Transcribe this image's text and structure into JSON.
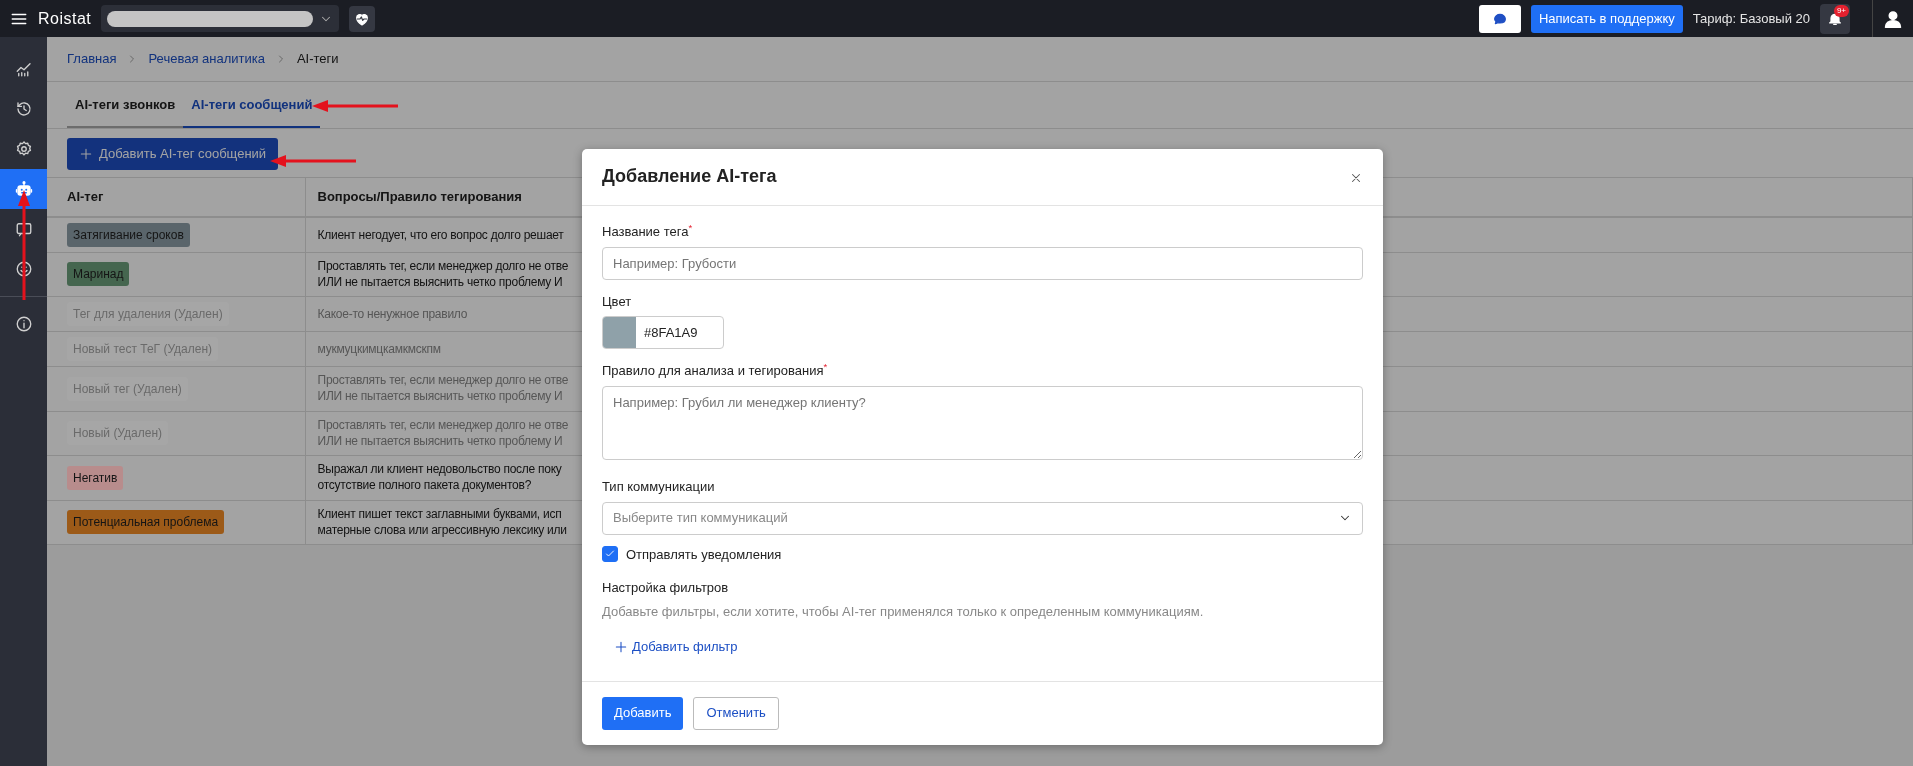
{
  "topbar": {
    "logo": "Roistat",
    "support_button": "Написать в поддержку",
    "tariff": "Тариф: Базовый 20",
    "notifications_badge": "9+"
  },
  "sidebar": {
    "items": [
      {
        "kind": "chart",
        "selected": false
      },
      {
        "kind": "history",
        "selected": false
      },
      {
        "kind": "settings",
        "selected": false
      },
      {
        "kind": "robot",
        "selected": true
      },
      {
        "kind": "chat",
        "selected": false
      },
      {
        "kind": "smile",
        "selected": false
      },
      {
        "kind": "info",
        "selected": false
      }
    ]
  },
  "breadcrumbs": [
    {
      "label": "Главная",
      "link": true
    },
    {
      "label": "Речевая аналитика",
      "link": true
    },
    {
      "label": "AI-теги",
      "link": false
    }
  ],
  "tabs": [
    {
      "label": "AI-теги звонков",
      "selected": false
    },
    {
      "label": "AI-теги сообщений",
      "selected": true
    }
  ],
  "add_button": "Добавить AI-тег сообщений",
  "table": {
    "columns": [
      "AI-тег",
      "Вопросы/Правило тегирования"
    ],
    "rows": [
      {
        "tag": "Затягивание сроков",
        "color": "#5a656b",
        "deleted": false,
        "rule": "Клиент негодует, что его вопрос долго решает"
      },
      {
        "tag": "Маринад",
        "color": "#45664f",
        "deleted": false,
        "rule": "Проставлять тег, если менеджер долго не отве\nИЛИ не пытается выяснить четко проблему И"
      },
      {
        "tag": "Тег для удаления (Удален)",
        "color": "#a6a6a6",
        "deleted": true,
        "rule": "Какое-то ненужное правило"
      },
      {
        "tag": "Новый тест ТеГ (Удален)",
        "color": "#a6a6a6",
        "deleted": true,
        "rule": "мукмуцкимцкамкмскпм"
      },
      {
        "tag": "Новый тег (Удален)",
        "color": "#a6a6a6",
        "deleted": true,
        "rule": "Проставлять тег, если менеджер долго не отве\nИЛИ не пытается выяснить четко проблему И"
      },
      {
        "tag": "Новый (Удален)",
        "color": "#a6a6a6",
        "deleted": true,
        "rule": "Проставлять тег, если менеджер долго не отве\nИЛИ не пытается выяснить четко проблему И"
      },
      {
        "tag": "Негатив",
        "color": "#b88c8c",
        "deleted": false,
        "rule": "Выражал ли клиент недовольство после поку\nотсутствие полного пакета документов?"
      },
      {
        "tag": "Потенциальная проблема",
        "color": "#9c5a18",
        "deleted": false,
        "rule": "Клиент пишет текст заглавными буквами, исп\nматерные слова или агрессивную лексику или"
      }
    ]
  },
  "modal": {
    "title": "Добавление AI-тега",
    "name_field": {
      "label": "Название тега",
      "required_mark": "*",
      "placeholder": "Например: Грубости"
    },
    "color_field": {
      "label": "Цвет",
      "value": "#8FA1A9",
      "color": "#8fa1a9"
    },
    "rule_field": {
      "label": "Правило для анализа и тегирования",
      "required_mark": "*",
      "placeholder": "Например: Грубил ли менеджер клиенту?"
    },
    "type_field": {
      "label": "Тип коммуникации",
      "placeholder": "Выберите тип коммуникаций"
    },
    "notify": {
      "label": "Отправлять уведомления",
      "checked": true
    },
    "filters": {
      "title": "Настройка фильтров",
      "hint": "Добавьте фильтры, если хотите, чтобы AI-тег применялся только к определенным коммуникациям.",
      "add_link": "Добавить фильтр"
    },
    "buttons": [
      {
        "label": "Добавить",
        "kind": "primary"
      },
      {
        "label": "Отменить",
        "kind": "secondary"
      }
    ]
  }
}
